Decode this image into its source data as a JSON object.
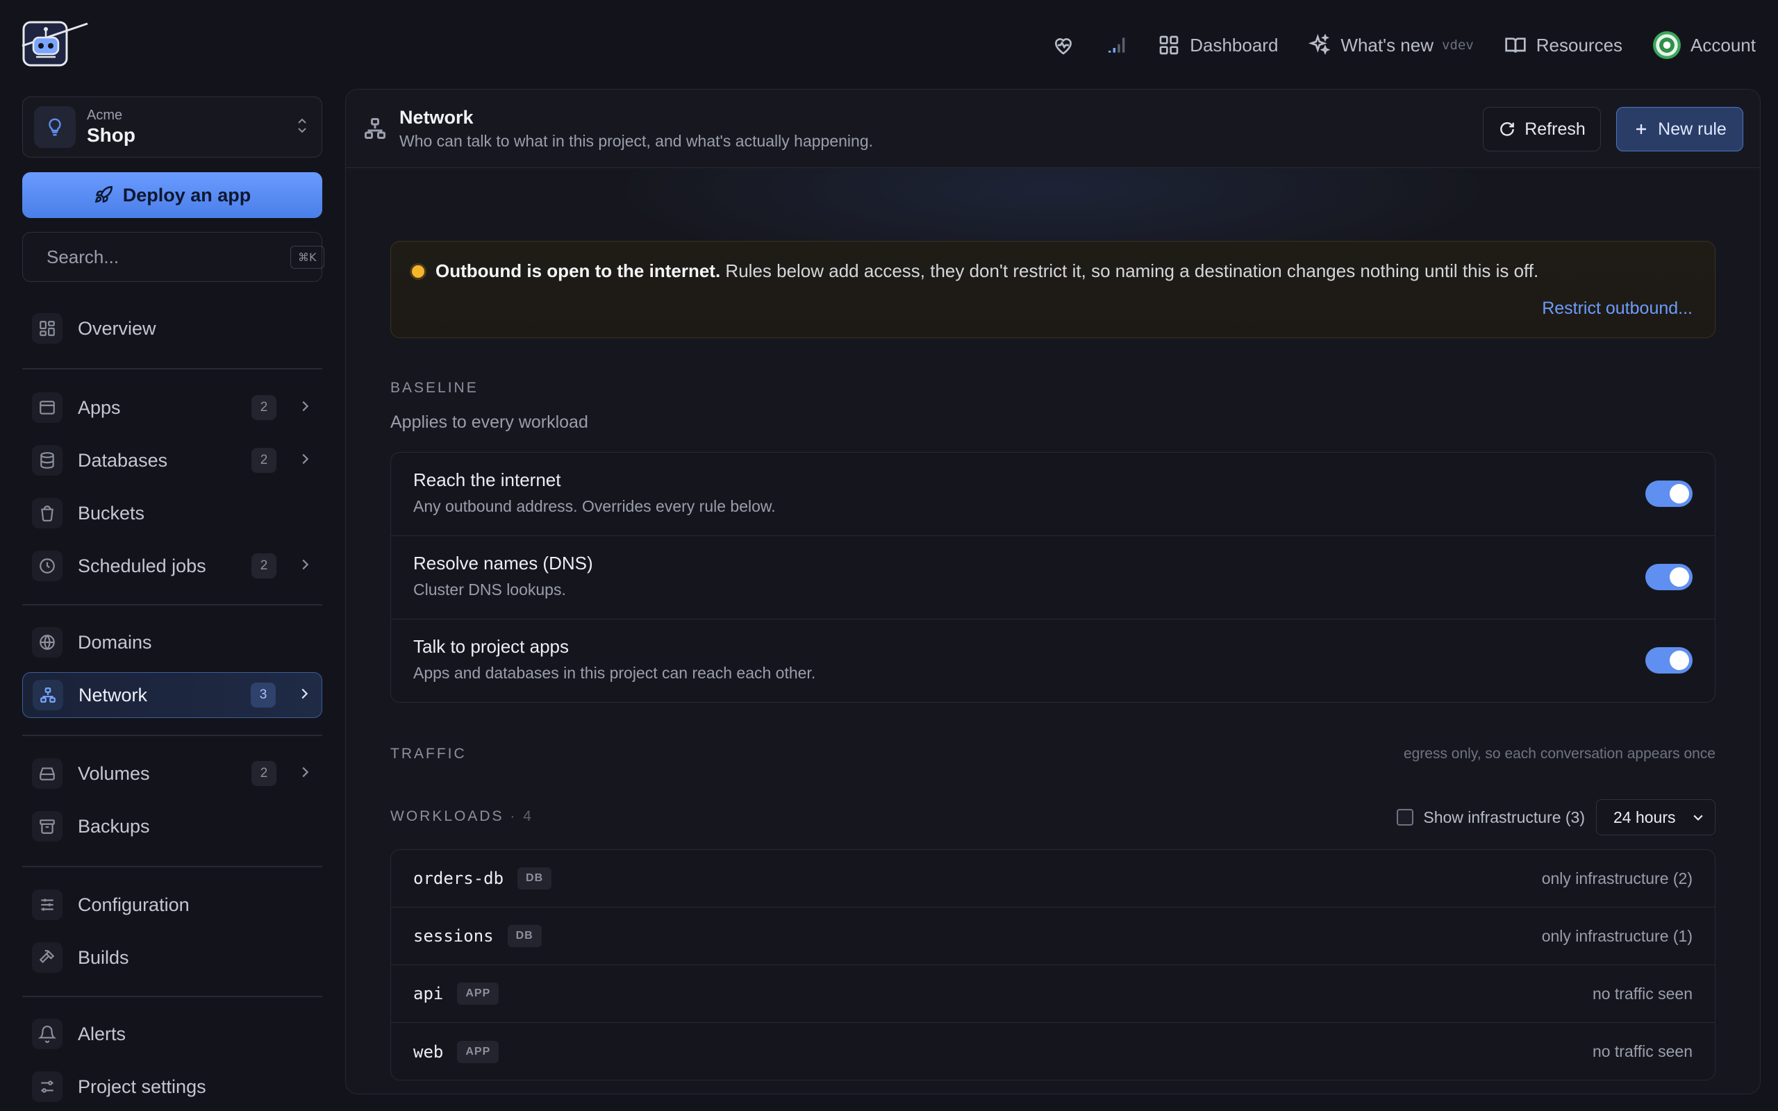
{
  "topnav": {
    "dashboard": "Dashboard",
    "whats_new": "What's new",
    "version": "vdev",
    "resources": "Resources",
    "account": "Account"
  },
  "project": {
    "org": "Acme",
    "name": "Shop"
  },
  "deploy_label": "Deploy an app",
  "search": {
    "placeholder": "Search...",
    "shortcut": "⌘K"
  },
  "sidebar": {
    "items": [
      {
        "label": "Overview"
      },
      {
        "label": "Apps",
        "count": "2"
      },
      {
        "label": "Databases",
        "count": "2"
      },
      {
        "label": "Buckets"
      },
      {
        "label": "Scheduled jobs",
        "count": "2"
      },
      {
        "label": "Domains"
      },
      {
        "label": "Network",
        "count": "3"
      },
      {
        "label": "Volumes",
        "count": "2"
      },
      {
        "label": "Backups"
      },
      {
        "label": "Configuration"
      },
      {
        "label": "Builds"
      },
      {
        "label": "Alerts"
      },
      {
        "label": "Project settings"
      }
    ]
  },
  "page": {
    "title": "Network",
    "subtitle": "Who can talk to what in this project, and what's actually happening.",
    "refresh": "Refresh",
    "new_rule": "New rule"
  },
  "alert": {
    "strong": "Outbound is open to the internet.",
    "text": " Rules below add access, they don't restrict it, so naming a destination changes nothing until this is off.",
    "link": "Restrict outbound..."
  },
  "baseline": {
    "heading": "BASELINE",
    "subtitle": "Applies to every workload",
    "rules": [
      {
        "title": "Reach the internet",
        "desc": "Any outbound address. Overrides every rule below.",
        "enabled": true
      },
      {
        "title": "Resolve names (DNS)",
        "desc": "Cluster DNS lookups.",
        "enabled": true
      },
      {
        "title": "Talk to project apps",
        "desc": "Apps and databases in this project can reach each other.",
        "enabled": true
      }
    ]
  },
  "traffic": {
    "heading": "TRAFFIC",
    "note": "egress only, so each conversation appears once"
  },
  "workloads": {
    "heading": "WORKLOADS",
    "count": "· 4",
    "show_infra": "Show infrastructure (3)",
    "range": "24 hours",
    "rows": [
      {
        "name": "orders-db",
        "kind": "DB",
        "status": "only infrastructure (2)"
      },
      {
        "name": "sessions",
        "kind": "DB",
        "status": "only infrastructure (1)"
      },
      {
        "name": "api",
        "kind": "APP",
        "status": "no traffic seen"
      },
      {
        "name": "web",
        "kind": "APP",
        "status": "no traffic seen"
      }
    ]
  },
  "colors": {
    "accent": "#5f8ff0",
    "warning": "#f5b62b",
    "background": "#13141b"
  }
}
